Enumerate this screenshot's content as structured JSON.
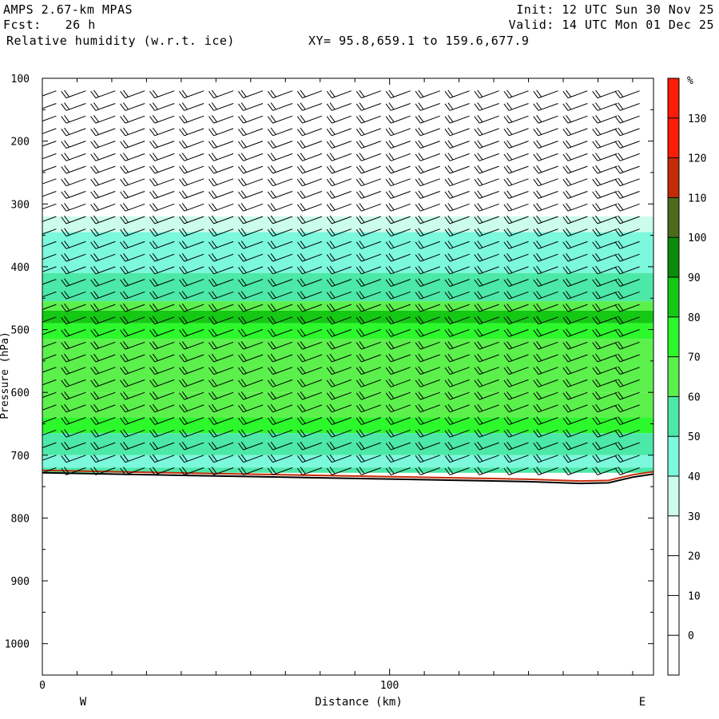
{
  "header": {
    "model": "AMPS 2.67-km MPAS",
    "fcst_label": "Fcst:",
    "fcst_value": "26 h",
    "field": "Relative humidity (w.r.t. ice)",
    "xy_label": "XY=",
    "xy_value": "95.8,659.1 to 159.6,677.9",
    "init": "Init: 12 UTC Sun 30 Nov 25",
    "valid": "Valid: 14 UTC Mon 01 Dec 25"
  },
  "chart_data": {
    "type": "heatmap",
    "title": "Relative humidity (w.r.t. ice)",
    "xlabel": "Distance (km)",
    "ylabel": "Pressure (hPa)",
    "xlim": [
      0,
      176
    ],
    "ylim": [
      100,
      1050
    ],
    "y_inverted": true,
    "x_ticks": [
      0,
      100
    ],
    "y_ticks": [
      100,
      200,
      300,
      400,
      500,
      600,
      700,
      800,
      900,
      1000
    ],
    "x_end_labels": {
      "left": "W",
      "right": "E"
    },
    "colorbar": {
      "unit": "%",
      "tick_labels": [
        "0",
        "10",
        "20",
        "30",
        "40",
        "50",
        "60",
        "70",
        "80",
        "90",
        "100",
        "110",
        "120",
        "130"
      ],
      "bins": [
        {
          "from": -10,
          "to": 30,
          "color": "#ffffff"
        },
        {
          "from": 30,
          "to": 40,
          "color": "#ccfcec"
        },
        {
          "from": 40,
          "to": 50,
          "color": "#7cf8dc"
        },
        {
          "from": 50,
          "to": 60,
          "color": "#4ce8a8"
        },
        {
          "from": 60,
          "to": 70,
          "color": "#5cf04c"
        },
        {
          "from": 70,
          "to": 80,
          "color": "#2cf82c"
        },
        {
          "from": 80,
          "to": 90,
          "color": "#14c814"
        },
        {
          "from": 90,
          "to": 100,
          "color": "#0a8c0a"
        },
        {
          "from": 100,
          "to": 110,
          "color": "#4c6c1c"
        },
        {
          "from": 110,
          "to": 120,
          "color": "#c42c08"
        },
        {
          "from": 120,
          "to": 140,
          "color": "#fc1c08"
        }
      ]
    },
    "rh_layers": [
      {
        "p_top": 320,
        "p_bot": 345,
        "rh": 35
      },
      {
        "p_top": 345,
        "p_bot": 410,
        "rh": 45
      },
      {
        "p_top": 410,
        "p_bot": 455,
        "rh": 55
      },
      {
        "p_top": 455,
        "p_bot": 470,
        "rh": 65
      },
      {
        "p_top": 470,
        "p_bot": 490,
        "rh": 85
      },
      {
        "p_top": 490,
        "p_bot": 515,
        "rh": 75
      },
      {
        "p_top": 515,
        "p_bot": 600,
        "rh": 65
      },
      {
        "p_top": 600,
        "p_bot": 640,
        "rh": 65
      },
      {
        "p_top": 640,
        "p_bot": 665,
        "rh": 75
      },
      {
        "p_top": 665,
        "p_bot": 700,
        "rh": 55
      },
      {
        "p_top": 700,
        "p_bot": 720,
        "rh": 45
      },
      {
        "p_top": 720,
        "p_bot": 728,
        "rh": 55
      }
    ],
    "surface_pressure": [
      {
        "x": 0,
        "p": 728
      },
      {
        "x": 20,
        "p": 730
      },
      {
        "x": 40,
        "p": 732
      },
      {
        "x": 60,
        "p": 734
      },
      {
        "x": 80,
        "p": 736
      },
      {
        "x": 100,
        "p": 738
      },
      {
        "x": 120,
        "p": 740
      },
      {
        "x": 140,
        "p": 742
      },
      {
        "x": 155,
        "p": 745
      },
      {
        "x": 163,
        "p": 744
      },
      {
        "x": 170,
        "p": 735
      },
      {
        "x": 176,
        "p": 730
      }
    ],
    "wind_barbs": {
      "x_positions": [
        4,
        12.5,
        21,
        29.5,
        38,
        46.5,
        55,
        63.5,
        72,
        80.5,
        89,
        97.5,
        106,
        114.5,
        123,
        131.5,
        140,
        148.5,
        157,
        165.5,
        172
      ],
      "p_levels": [
        120,
        140,
        160,
        180,
        200,
        220,
        240,
        260,
        280,
        300,
        320,
        340,
        360,
        380,
        400,
        420,
        440,
        460,
        480,
        500,
        520,
        540,
        560,
        580,
        600,
        620,
        640,
        660,
        680,
        700,
        720
      ],
      "direction_deg": 250,
      "speed_kt": 20
    }
  }
}
